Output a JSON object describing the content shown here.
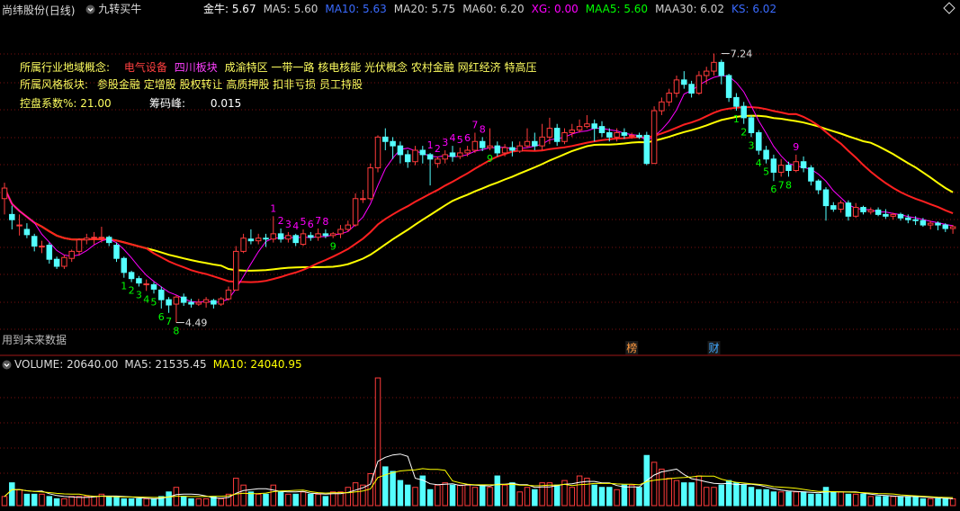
{
  "colors": {
    "up": "#ff3b3b",
    "down": "#54ffff",
    "ma5": "#ff00ff",
    "ma20": "#ff2020",
    "ma60": "#ffff00",
    "vol_ma5": "#ffffff",
    "vol_ma10": "#ffff00",
    "grid": "#7a1010",
    "header": "#d0d0d0"
  },
  "header": {
    "stock": "尚纬股份",
    "period": "(日线)",
    "indicator_icon": "chevron-down-icon",
    "indicator": "九转买牛",
    "items": [
      {
        "label": "金牛: 5.67",
        "color": "#ffffff"
      },
      {
        "label": "MA5: 5.60",
        "color": "#d0d0d0"
      },
      {
        "label": "MA10: 5.63",
        "color": "#3a6bff"
      },
      {
        "label": "MA20: 5.75",
        "color": "#d0d0d0"
      },
      {
        "label": "MA60: 6.20",
        "color": "#d0d0d0"
      },
      {
        "label": "XG: 0.00",
        "color": "#ff00ff"
      },
      {
        "label": "MAA5: 5.60",
        "color": "#00ff00"
      },
      {
        "label": "MAA30: 6.02",
        "color": "#d0d0d0"
      },
      {
        "label": "KS: 6.02",
        "color": "#3a6bff"
      }
    ]
  },
  "info": {
    "industry_label": "所属行业地域概念:",
    "industry_red": "电气设备",
    "industry_magenta": "四川板块",
    "industry_rest": "成渝特区 一带一路 核电核能 光伏概念 农村金融 网红经济 特高压",
    "style_label": "所属风格板块:",
    "style_values": "参股金融 定增股 股权转让 高质押股 扣非亏损 员工持股",
    "control_label": "控盘系数%:",
    "control_value": "21.00",
    "chip_label": "筹码峰:",
    "chip_value": "0.015"
  },
  "labels": {
    "future_data": "用到未来数据",
    "low_price": "4.49",
    "high_price": "7.24",
    "event1": "榜",
    "event2": "财"
  },
  "volume_header": {
    "label": "VOLUME: 20640.00",
    "ma5": "MA5: 21535.45",
    "ma10": "MA10: 24040.95"
  },
  "candles": [
    [
      5.9,
      6.02,
      6.08,
      5.72
    ],
    [
      5.72,
      5.66,
      5.82,
      5.55
    ],
    [
      5.6,
      5.6,
      5.72,
      5.48
    ],
    [
      5.55,
      5.49,
      5.62,
      5.45
    ],
    [
      5.47,
      5.36,
      5.5,
      5.3
    ],
    [
      5.35,
      5.36,
      5.42,
      5.28
    ],
    [
      5.37,
      5.21,
      5.4,
      5.16
    ],
    [
      5.21,
      5.13,
      5.24,
      5.1
    ],
    [
      5.13,
      5.23,
      5.26,
      5.1
    ],
    [
      5.22,
      5.3,
      5.32,
      5.18
    ],
    [
      5.3,
      5.43,
      5.45,
      5.25
    ],
    [
      5.43,
      5.45,
      5.5,
      5.38
    ],
    [
      5.45,
      5.46,
      5.52,
      5.38
    ],
    [
      5.46,
      5.46,
      5.58,
      5.4
    ],
    [
      5.46,
      5.4,
      5.48,
      5.36
    ],
    [
      5.37,
      5.22,
      5.4,
      5.18
    ],
    [
      5.22,
      5.06,
      5.24,
      5.0
    ],
    [
      5.06,
      4.99,
      5.08,
      4.95
    ],
    [
      4.99,
      4.94,
      5.02,
      4.9
    ],
    [
      4.92,
      4.93,
      4.98,
      4.85
    ],
    [
      4.92,
      4.87,
      4.95,
      4.82
    ],
    [
      4.86,
      4.75,
      4.9,
      4.65
    ],
    [
      4.75,
      4.69,
      4.78,
      4.6
    ],
    [
      4.7,
      4.78,
      4.8,
      4.49
    ],
    [
      4.78,
      4.72,
      4.82,
      4.68
    ],
    [
      4.72,
      4.7,
      4.76,
      4.66
    ],
    [
      4.7,
      4.72,
      4.76,
      4.68
    ],
    [
      4.72,
      4.75,
      4.78,
      4.66
    ],
    [
      4.74,
      4.7,
      4.76,
      4.65
    ],
    [
      4.7,
      4.76,
      4.78,
      4.68
    ],
    [
      4.76,
      4.86,
      4.9,
      4.74
    ],
    [
      4.86,
      5.3,
      5.36,
      4.86
    ],
    [
      5.3,
      5.45,
      5.5,
      5.28
    ],
    [
      5.44,
      5.42,
      5.55,
      5.38
    ],
    [
      5.42,
      5.45,
      5.5,
      5.38
    ],
    [
      5.45,
      5.44,
      5.5,
      5.35
    ],
    [
      5.44,
      5.5,
      5.7,
      5.4
    ],
    [
      5.5,
      5.44,
      5.56,
      5.4
    ],
    [
      5.44,
      5.48,
      5.52,
      5.4
    ],
    [
      5.48,
      5.4,
      5.5,
      5.36
    ],
    [
      5.38,
      5.5,
      5.55,
      5.36
    ],
    [
      5.48,
      5.46,
      5.52,
      5.42
    ],
    [
      5.46,
      5.5,
      5.56,
      5.42
    ],
    [
      5.5,
      5.48,
      5.55,
      5.45
    ],
    [
      5.48,
      5.5,
      5.52,
      5.45
    ],
    [
      5.5,
      5.55,
      5.6,
      5.45
    ],
    [
      5.55,
      5.6,
      5.65,
      5.52
    ],
    [
      5.6,
      5.9,
      5.96,
      5.58
    ],
    [
      5.9,
      5.9,
      6.0,
      5.85
    ],
    [
      5.9,
      6.25,
      6.3,
      5.88
    ],
    [
      6.25,
      6.6,
      6.62,
      6.2
    ],
    [
      6.6,
      6.55,
      6.7,
      6.45
    ],
    [
      6.55,
      6.5,
      6.6,
      6.35
    ],
    [
      6.5,
      6.4,
      6.55,
      6.3
    ],
    [
      6.4,
      6.32,
      6.45,
      6.25
    ],
    [
      6.32,
      6.45,
      6.5,
      6.28
    ],
    [
      6.45,
      6.4,
      6.5,
      6.3
    ],
    [
      6.4,
      6.35,
      6.42,
      6.05
    ],
    [
      6.3,
      6.35,
      6.38,
      6.25
    ],
    [
      6.35,
      6.4,
      6.45,
      6.3
    ],
    [
      6.42,
      6.38,
      6.5,
      6.32
    ],
    [
      6.38,
      6.42,
      6.48,
      6.35
    ],
    [
      6.42,
      6.45,
      6.5,
      6.38
    ],
    [
      6.45,
      6.55,
      6.65,
      6.42
    ],
    [
      6.55,
      6.48,
      6.6,
      6.44
    ],
    [
      6.48,
      6.5,
      6.7,
      6.45
    ],
    [
      6.5,
      6.42,
      6.55,
      6.38
    ],
    [
      6.42,
      6.48,
      6.52,
      6.38
    ],
    [
      6.48,
      6.45,
      6.55,
      6.38
    ],
    [
      6.44,
      6.5,
      6.55,
      6.42
    ],
    [
      6.5,
      6.55,
      6.7,
      6.48
    ],
    [
      6.55,
      6.5,
      6.65,
      6.45
    ],
    [
      6.5,
      6.6,
      6.75,
      6.45
    ],
    [
      6.6,
      6.7,
      6.82,
      6.52
    ],
    [
      6.7,
      6.55,
      6.75,
      6.5
    ],
    [
      6.55,
      6.65,
      6.7,
      6.52
    ],
    [
      6.65,
      6.68,
      6.75,
      6.6
    ],
    [
      6.68,
      6.72,
      6.8,
      6.65
    ],
    [
      6.72,
      6.75,
      6.85,
      6.7
    ],
    [
      6.75,
      6.7,
      6.8,
      6.55
    ],
    [
      6.72,
      6.65,
      6.78,
      6.6
    ],
    [
      6.65,
      6.6,
      6.7,
      6.55
    ],
    [
      6.6,
      6.65,
      6.7,
      6.55
    ],
    [
      6.65,
      6.62,
      6.7,
      6.58
    ],
    [
      6.62,
      6.62,
      6.65,
      6.58
    ],
    [
      6.62,
      6.6,
      6.65,
      6.58
    ],
    [
      6.62,
      6.3,
      6.66,
      6.28
    ],
    [
      6.3,
      6.9,
      6.95,
      6.3
    ],
    [
      6.9,
      7.0,
      7.05,
      6.85
    ],
    [
      7.0,
      7.1,
      7.15,
      6.95
    ],
    [
      7.1,
      7.25,
      7.3,
      7.05
    ],
    [
      7.25,
      7.2,
      7.35,
      7.15
    ],
    [
      7.2,
      7.1,
      7.24,
      7.05
    ],
    [
      7.1,
      7.3,
      7.35,
      7.08
    ],
    [
      7.3,
      7.35,
      7.4,
      7.2
    ],
    [
      7.35,
      7.45,
      7.55,
      7.3
    ],
    [
      7.45,
      7.3,
      7.48,
      7.2
    ],
    [
      7.3,
      7.05,
      7.32,
      7.0
    ],
    [
      7.05,
      6.95,
      7.1,
      6.9
    ],
    [
      6.95,
      6.82,
      7.0,
      6.75
    ],
    [
      6.82,
      6.65,
      6.85,
      6.6
    ],
    [
      6.65,
      6.45,
      6.68,
      6.4
    ],
    [
      6.45,
      6.35,
      6.5,
      6.3
    ],
    [
      6.35,
      6.2,
      6.4,
      6.1
    ],
    [
      6.2,
      6.28,
      6.35,
      6.15
    ],
    [
      6.28,
      6.22,
      6.32,
      6.15
    ],
    [
      6.22,
      6.32,
      6.4,
      6.2
    ],
    [
      6.32,
      6.25,
      6.38,
      6.2
    ],
    [
      6.25,
      6.1,
      6.28,
      6.05
    ],
    [
      6.1,
      6.0,
      6.12,
      5.95
    ],
    [
      6.0,
      5.82,
      6.03,
      5.65
    ],
    [
      5.82,
      5.78,
      5.86,
      5.75
    ],
    [
      5.78,
      5.85,
      5.88,
      5.74
    ],
    [
      5.85,
      5.7,
      5.88,
      5.65
    ],
    [
      5.7,
      5.8,
      5.85,
      5.68
    ],
    [
      5.8,
      5.75,
      5.82,
      5.72
    ],
    [
      5.75,
      5.77,
      5.8,
      5.72
    ],
    [
      5.77,
      5.72,
      5.8,
      5.7
    ],
    [
      5.72,
      5.7,
      5.78,
      5.67
    ],
    [
      5.7,
      5.72,
      5.74,
      5.66
    ],
    [
      5.72,
      5.68,
      5.74,
      5.65
    ],
    [
      5.68,
      5.66,
      5.72,
      5.62
    ],
    [
      5.66,
      5.65,
      5.7,
      5.6
    ],
    [
      5.65,
      5.6,
      5.68,
      5.58
    ],
    [
      5.6,
      5.62,
      5.65,
      5.55
    ],
    [
      5.62,
      5.6,
      5.64,
      5.54
    ],
    [
      5.6,
      5.56,
      5.62,
      5.52
    ],
    [
      5.56,
      5.58,
      5.6,
      5.5
    ]
  ],
  "volumes": [
    4,
    10,
    7,
    5,
    5,
    5,
    4,
    3,
    3,
    4,
    4,
    4,
    4,
    5,
    4,
    4,
    3,
    3,
    3,
    3,
    3,
    4,
    6,
    8,
    4,
    3,
    3,
    3,
    4,
    3,
    5,
    12,
    9,
    6,
    5,
    5,
    9,
    6,
    5,
    5,
    6,
    5,
    5,
    4,
    6,
    6,
    8,
    10,
    9,
    14,
    56,
    17,
    15,
    11,
    9,
    8,
    13,
    7,
    9,
    10,
    9,
    9,
    9,
    8,
    9,
    8,
    13,
    9,
    10,
    6,
    8,
    7,
    10,
    10,
    9,
    11,
    8,
    13,
    12,
    9,
    8,
    8,
    7,
    9,
    9,
    8,
    22,
    19,
    16,
    12,
    11,
    10,
    10,
    13,
    8,
    8,
    9,
    11,
    10,
    9,
    8,
    7,
    7,
    6,
    6,
    6,
    6,
    6,
    5,
    5,
    8,
    6,
    6,
    5,
    5,
    5,
    4,
    4,
    4,
    4,
    4,
    4,
    4,
    3,
    3,
    3,
    3,
    3
  ],
  "nine_turn": [
    {
      "i": 16,
      "t": "1",
      "c": "#00ff00"
    },
    {
      "i": 17,
      "t": "2",
      "c": "#00ff00"
    },
    {
      "i": 18,
      "t": "3",
      "c": "#00ff00"
    },
    {
      "i": 19,
      "t": "4",
      "c": "#00ff00"
    },
    {
      "i": 20,
      "t": "5",
      "c": "#00ff00"
    },
    {
      "i": 21,
      "t": "6",
      "c": "#00ff00"
    },
    {
      "i": 22,
      "t": "7",
      "c": "#00ff00"
    },
    {
      "i": 23,
      "t": "8",
      "c": "#00ff00"
    },
    {
      "i": 36,
      "t": "1",
      "c": "#ff00ff"
    },
    {
      "i": 37,
      "t": "2",
      "c": "#ff00ff"
    },
    {
      "i": 38,
      "t": "3",
      "c": "#ff00ff"
    },
    {
      "i": 39,
      "t": "4",
      "c": "#ff00ff"
    },
    {
      "i": 40,
      "t": "5",
      "c": "#ff00ff"
    },
    {
      "i": 41,
      "t": "6",
      "c": "#ff00ff"
    },
    {
      "i": 42,
      "t": "7",
      "c": "#ff00ff"
    },
    {
      "i": 43,
      "t": "8",
      "c": "#ff00ff"
    },
    {
      "i": 44,
      "t": "9",
      "c": "#00ff00"
    },
    {
      "i": 57,
      "t": "1",
      "c": "#ff00ff"
    },
    {
      "i": 58,
      "t": "2",
      "c": "#ff00ff"
    },
    {
      "i": 59,
      "t": "3",
      "c": "#ff00ff"
    },
    {
      "i": 60,
      "t": "4",
      "c": "#ff00ff"
    },
    {
      "i": 61,
      "t": "5",
      "c": "#ff00ff"
    },
    {
      "i": 62,
      "t": "6",
      "c": "#ff00ff"
    },
    {
      "i": 63,
      "t": "7",
      "c": "#ff00ff"
    },
    {
      "i": 64,
      "t": "8",
      "c": "#ff00ff"
    },
    {
      "i": 65,
      "t": "9",
      "c": "#00ff00"
    },
    {
      "i": 98,
      "t": "1",
      "c": "#00ff00"
    },
    {
      "i": 99,
      "t": "2",
      "c": "#00ff00"
    },
    {
      "i": 100,
      "t": "3",
      "c": "#00ff00"
    },
    {
      "i": 101,
      "t": "4",
      "c": "#00ff00"
    },
    {
      "i": 102,
      "t": "5",
      "c": "#00ff00"
    },
    {
      "i": 103,
      "t": "6",
      "c": "#00ff00"
    },
    {
      "i": 104,
      "t": "7",
      "c": "#00ff00"
    },
    {
      "i": 105,
      "t": "8",
      "c": "#00ff00"
    },
    {
      "i": 106,
      "t": "9",
      "c": "#ff00ff"
    }
  ]
}
